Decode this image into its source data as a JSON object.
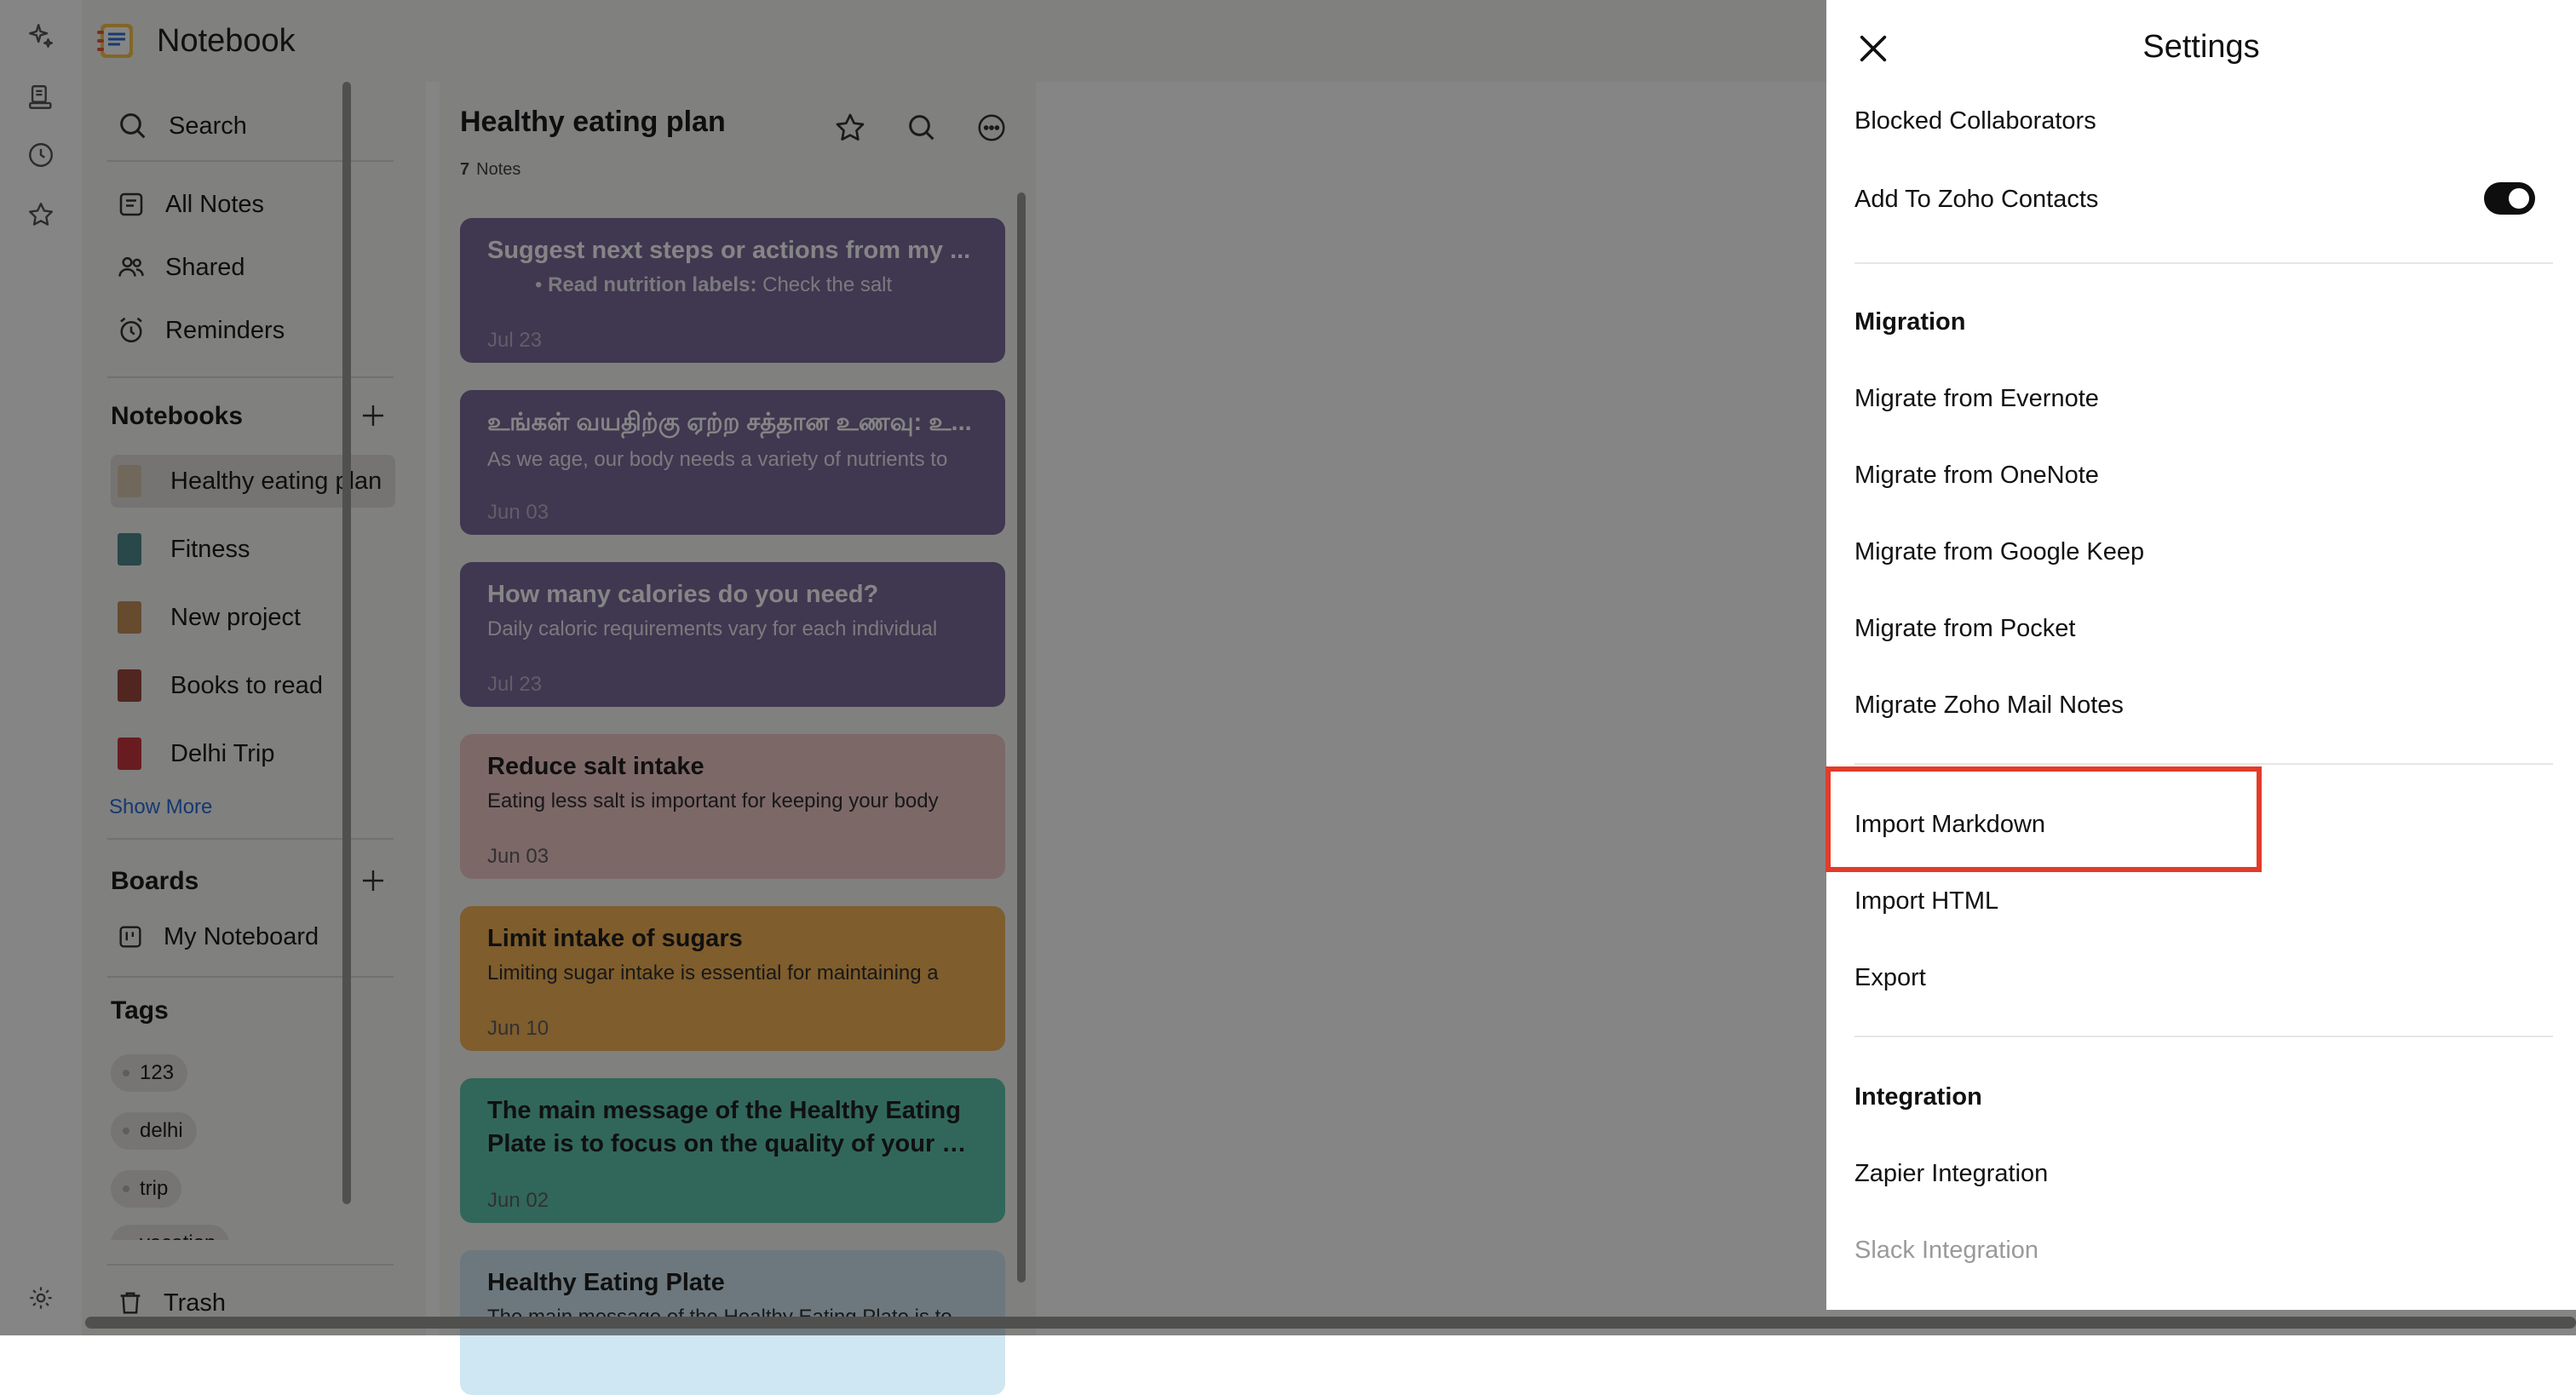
{
  "app": {
    "title": "Notebook"
  },
  "rail": {
    "icons": [
      "sparkle-icon",
      "notecards-icon",
      "history-icon",
      "star-icon",
      "settings-gear-icon"
    ]
  },
  "sidebar": {
    "search_label": "Search",
    "nav": [
      {
        "label": "All Notes",
        "icon": "notes-icon"
      },
      {
        "label": "Shared",
        "icon": "people-icon"
      },
      {
        "label": "Reminders",
        "icon": "alarm-icon"
      }
    ],
    "notebooks_header": "Notebooks",
    "notebooks": [
      {
        "label": "Healthy eating plan",
        "active": true,
        "color": "#d9c7b0"
      },
      {
        "label": "Fitness",
        "active": false,
        "color": "#4e8b8d"
      },
      {
        "label": "New project",
        "active": false,
        "color": "#c6905a"
      },
      {
        "label": "Books to read",
        "active": false,
        "color": "#9b4a3f"
      },
      {
        "label": "Delhi Trip",
        "active": false,
        "color": "#c9373f"
      }
    ],
    "show_more": "Show More",
    "boards_header": "Boards",
    "boards": [
      {
        "label": "My Noteboard",
        "icon": "board-icon"
      }
    ],
    "tags_header": "Tags",
    "tags": [
      "123",
      "delhi",
      "trip",
      "vacation"
    ],
    "trash_label": "Trash"
  },
  "notelist": {
    "title": "Healthy eating plan",
    "count": "7",
    "count_label": "Notes",
    "cards": [
      {
        "title": "Suggest next steps or actions from my ...",
        "preview_bold": "Read nutrition labels:",
        "preview": "Check the salt",
        "date": "Jul 23",
        "color": "#7b6a9a",
        "theme": "dark"
      },
      {
        "title": "உங்கள் வயதிற்கு ஏற்ற சத்தான உணவு: உ...",
        "preview": "As we age, our body needs a variety of nutrients to",
        "date": "Jun 03",
        "color": "#7b6a9a",
        "theme": "dark"
      },
      {
        "title": "How many calories do you need?",
        "preview": "Daily caloric requirements vary for each individual",
        "date": "Jul 23",
        "color": "#7b6a9a",
        "theme": "dark"
      },
      {
        "title": "Reduce salt intake",
        "preview": "Eating less salt is important for keeping your body",
        "date": "Jun 03",
        "color": "#f0c8c8",
        "theme": "light"
      },
      {
        "title": "Limit intake of sugars",
        "preview": "Limiting sugar intake is essential for maintaining a",
        "date": "Jun 10",
        "color": "#f4b355",
        "theme": "light"
      },
      {
        "title": "The main message of the Healthy Eating",
        "title2": "Plate is to focus on the quality of your diet,",
        "date": "Jun 02",
        "color": "#5fc6ad",
        "theme": "light"
      },
      {
        "title": "Healthy Eating Plate",
        "preview": "The main message of the Healthy Eating Plate is to",
        "color": "#cfe7f2",
        "theme": "light"
      }
    ]
  },
  "settings": {
    "title": "Settings",
    "blocked": "Blocked Collaborators",
    "add_contacts": "Add To Zoho Contacts",
    "add_contacts_on": true,
    "migration_header": "Migration",
    "migration": [
      "Migrate from Evernote",
      "Migrate from OneNote",
      "Migrate from Google Keep",
      "Migrate from Pocket",
      "Migrate Zoho Mail Notes"
    ],
    "import_markdown": "Import Markdown",
    "import_html": "Import HTML",
    "export": "Export",
    "integration_header": "Integration",
    "zapier": "Zapier Integration",
    "slack": "Slack Integration"
  },
  "highlight_color": "#e23b2a"
}
